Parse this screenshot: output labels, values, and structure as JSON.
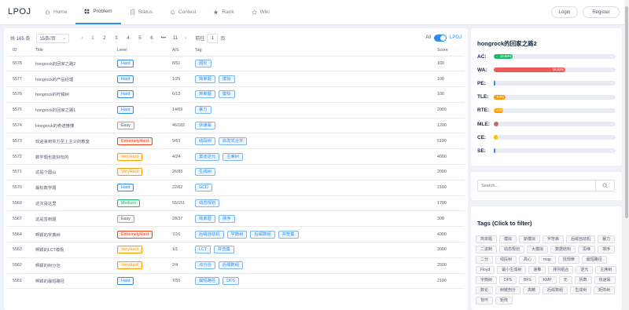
{
  "app": {
    "logo": "LPOJ"
  },
  "nav": {
    "items": [
      {
        "label": "Home",
        "icon": "home-icon"
      },
      {
        "label": "Problem",
        "icon": "grid-icon"
      },
      {
        "label": "Status",
        "icon": "document-icon"
      },
      {
        "label": "Contest",
        "icon": "bell-icon"
      },
      {
        "label": "Rank",
        "icon": "star-filled-icon"
      },
      {
        "label": "Wiki",
        "icon": "star-outline-icon"
      }
    ],
    "login": "Login",
    "register": "Register"
  },
  "pager": {
    "total": "共 165 条",
    "page_size": "15条/页",
    "pages": [
      "1",
      "2",
      "3",
      "4",
      "5",
      "6",
      "•••",
      "11"
    ],
    "current_page": "1",
    "goto_prefix": "前往",
    "goto_value": "1",
    "goto_suffix": "页",
    "prev": "‹",
    "next": "›"
  },
  "filter": {
    "all_label": "All",
    "lpoj_label": "LPOJ",
    "lpoj_on": true
  },
  "table": {
    "headers": {
      "id": "ID",
      "title": "Title",
      "level": "Level",
      "ac": "A/S",
      "tag": "Tag",
      "score": "Score"
    },
    "rows": [
      {
        "id": "5578",
        "title": "hongrock的回家之路2",
        "level": "Hard",
        "ac": "8/51",
        "tags": [
          "图论"
        ],
        "score": "100"
      },
      {
        "id": "5577",
        "title": "hongrock的产品经理",
        "level": "Hard",
        "ac": "1/25",
        "tags": [
          "简单题",
          "模拟"
        ],
        "score": "100"
      },
      {
        "id": "5576",
        "title": "hongrock的柠檬树",
        "level": "Hard",
        "ac": "6/13",
        "tags": [
          "简单题",
          "模拟"
        ],
        "score": "100"
      },
      {
        "id": "5575",
        "title": "hongrock的回家之路1",
        "level": "Hard",
        "ac": "14/69",
        "tags": [
          "暴力"
        ],
        "score": "2000"
      },
      {
        "id": "5574",
        "title": "Hongrock的奇迹懂懂",
        "level": "Easy",
        "ac": "46/182",
        "tags": [
          "快速幂"
        ],
        "score": "1200"
      },
      {
        "id": "5573",
        "title": "欢迎来到实力至上主义的教室",
        "level": "ExtremelyHard",
        "ac": "9/63",
        "tags": [
          "线段树",
          "启发式合并"
        ],
        "score": "5100"
      },
      {
        "id": "5572",
        "title": "数学题也能好玩的",
        "level": "VeryHard",
        "ac": "4/24",
        "tags": [
          "莫迪逆元",
          "主席树"
        ],
        "score": "4000"
      },
      {
        "id": "5571",
        "title": "这是个圆山",
        "level": "VeryHard",
        "ac": "26/83",
        "tags": [
          "生成树"
        ],
        "score": "2000"
      },
      {
        "id": "5570",
        "title": "最松数学题",
        "level": "Hard",
        "ac": "22/62",
        "tags": [
          "GCD"
        ],
        "score": "2100"
      },
      {
        "id": "5569",
        "title": "这次是这里",
        "level": "Medium",
        "ac": "55/151",
        "tags": [
          "动态规划"
        ],
        "score": "1700"
      },
      {
        "id": "5567",
        "title": "这是签到题",
        "level": "Easy",
        "ac": "28/37",
        "tags": [
          "简单题",
          "排序"
        ],
        "score": "300"
      },
      {
        "id": "5564",
        "title": "啊颖的字典树",
        "level": "ExtremelyHard",
        "ac": "7/16",
        "tags": [
          "后缀自动机",
          "字典树",
          "后缀数组",
          "并查集"
        ],
        "score": "4300"
      },
      {
        "id": "5563",
        "title": "啊颖的LCT模板",
        "level": "VeryHard",
        "ac": "1/1",
        "tags": [
          "LCT",
          "并查集"
        ],
        "score": "3000"
      },
      {
        "id": "5562",
        "title": "啊颖的树分治",
        "level": "VeryHard",
        "ac": "2/4",
        "tags": [
          "点分治",
          "后缀数组"
        ],
        "score": "2500"
      },
      {
        "id": "5561",
        "title": "啊颖的最短路径",
        "level": "Hard",
        "ac": "7/55",
        "tags": [
          "最短路径",
          "DFS"
        ],
        "score": "2100"
      }
    ]
  },
  "stats": {
    "title": "hongrock的回家之路2",
    "rows": [
      {
        "label": "AC:",
        "percent": 15.69,
        "text": "15.69%",
        "color": "#19be6b"
      },
      {
        "label": "WA:",
        "percent": 58.82,
        "text": "58.82%",
        "color": "#ed5a5a"
      },
      {
        "label": "PE:",
        "percent": 0,
        "text": "",
        "color": "#2d8cf0"
      },
      {
        "label": "TLE:",
        "percent": 9.8,
        "text": "9.8%",
        "color": "#ff9900"
      },
      {
        "label": "RTE:",
        "percent": 7.84,
        "text": "7.84%",
        "color": "#ff9900"
      },
      {
        "label": "MLE:",
        "percent": 3.92,
        "text": "",
        "color": "#b0756e"
      },
      {
        "label": "CE:",
        "percent": 1.96,
        "text": "",
        "color": "#ffc107"
      },
      {
        "label": "SE:",
        "percent": 0,
        "text": "",
        "color": "#2d8cf0"
      }
    ]
  },
  "search": {
    "placeholder": "Search..."
  },
  "tags_panel": {
    "title": "Tags (Click to filter)",
    "tags": [
      "简单题",
      "模拟",
      "斯模拟",
      "字符串",
      "后缀自动机",
      "暴力",
      "二进制",
      "动态规划",
      "大模拟",
      "数据结构",
      "思维",
      "排序",
      "二分",
      "线段树",
      "高心",
      "map",
      "找规律",
      "最短路径",
      "Floyd",
      "最小生成树",
      "递推",
      "排列组合",
      "逆元",
      "主席树",
      "字典树",
      "DFS",
      "BFS",
      "KMP",
      "无",
      "拆数",
      "快速幂",
      "数论",
      "树链剖分",
      "高精",
      "后缀数组",
      "生成树",
      "矩阵树",
      "背环",
      "矩阵"
    ]
  }
}
